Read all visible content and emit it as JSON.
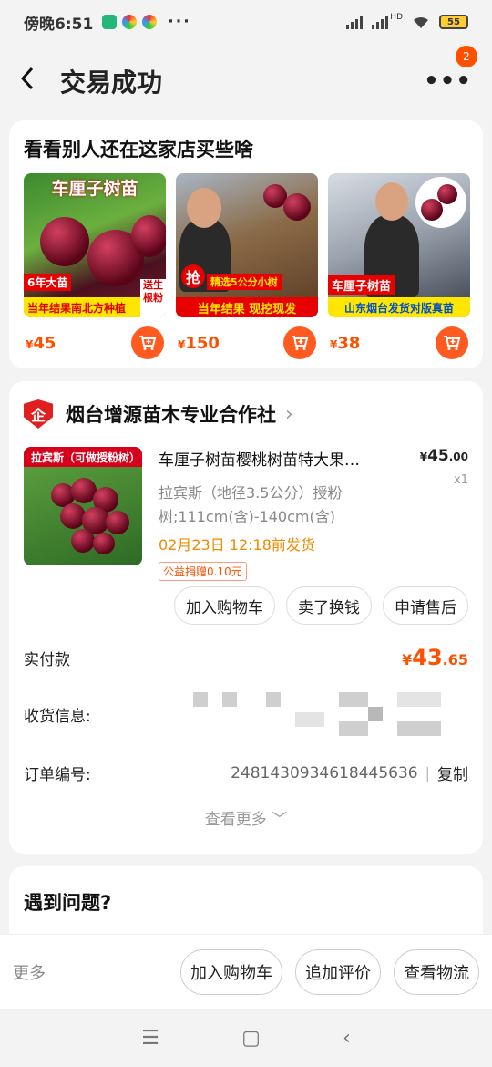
{
  "status_bar": {
    "time": "傍晚6:51",
    "more": "···",
    "battery": "55",
    "network": "HD"
  },
  "header": {
    "back_icon": "chevron-left-icon",
    "title": "交易成功",
    "menu_icon": "more-dots-icon",
    "badge": "2"
  },
  "recommendations": {
    "title": "看看别人还在这家店买些啥",
    "items": [
      {
        "banner_top": "车厘子树苗",
        "banner_bottom": "当年结果南北方种植",
        "tag": "6年大苗",
        "side_tag": "送生根粉",
        "currency": "¥",
        "price": "45"
      },
      {
        "banner_top": "抢",
        "banner_mid": "精选5公分小树",
        "banner_bottom": "当年结果  现挖现发",
        "currency": "¥",
        "price": "150"
      },
      {
        "banner_top": "车厘子树苗",
        "banner_bottom": "山东烟台发货对版真苗",
        "currency": "¥",
        "price": "38"
      }
    ]
  },
  "order": {
    "shop_logo": "企",
    "shop_name": "烟台增源苗木专业合作社",
    "item": {
      "image_tag": "拉宾斯（可做授粉树）",
      "title": "车厘子树苗樱桃树苗特大果…",
      "price_currency": "¥",
      "price_int": "45",
      "price_dec": ".00",
      "quantity": "x1",
      "sku": "拉宾斯（地径3.5公分）授粉树;111cm(含)-140cm(含)",
      "ship": "02月23日 12:18前发货",
      "charity": "公益捐赠0.10元"
    },
    "actions": [
      "加入购物车",
      "卖了换钱",
      "申请售后"
    ],
    "paid_label": "实付款",
    "paid_currency": "¥",
    "paid_int": "43",
    "paid_dec": ".65",
    "address_label": "收货信息:",
    "order_no_label": "订单编号:",
    "order_no": "2481430934618445636",
    "copy": "复制",
    "see_more": "查看更多 ﹀"
  },
  "problem": {
    "title": "遇到问题?"
  },
  "bottom_bar": {
    "more": "更多",
    "buttons": [
      "加入购物车",
      "追加评价",
      "查看物流"
    ]
  },
  "nav": {
    "menu": "☰",
    "home": "▢",
    "back": "‹"
  },
  "colors": {
    "accent": "#ff5000",
    "ship": "#f08a00",
    "background": "#f3f3f3"
  }
}
